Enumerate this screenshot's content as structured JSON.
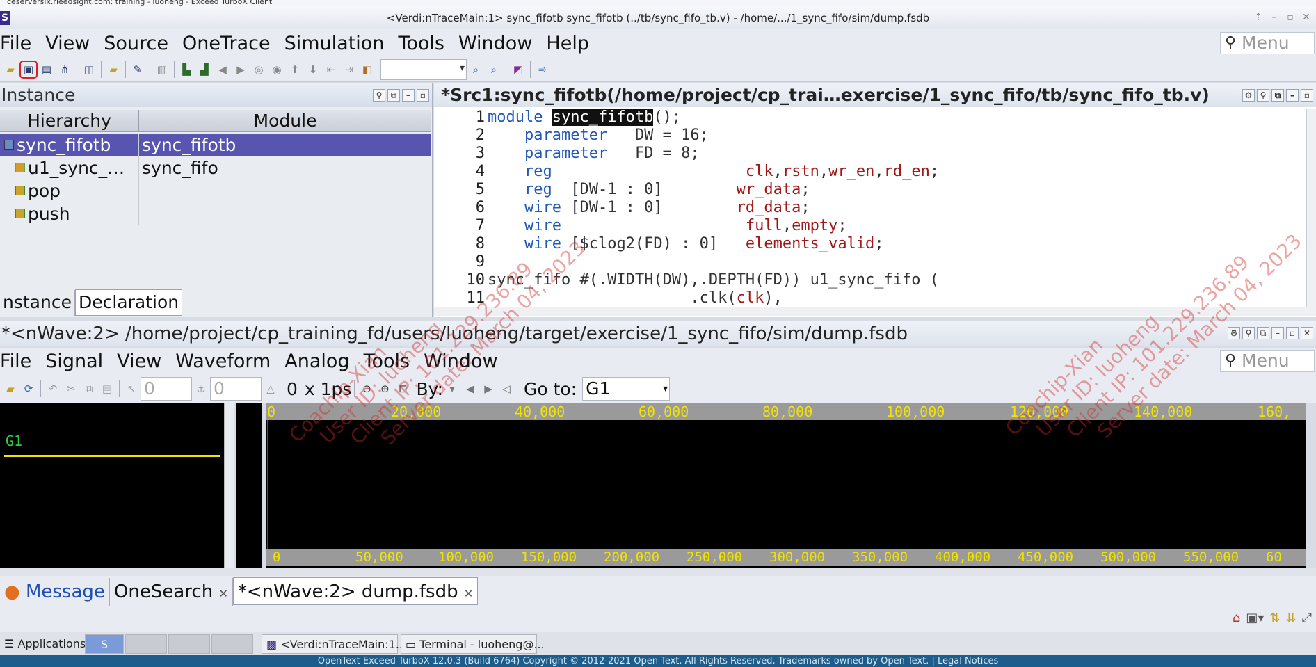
{
  "top_strip": {
    "text": "ceserversix.rieedsignt.com: training - luoheng - Exceed TurboX Client"
  },
  "title_bar": {
    "title": "<Verdi:nTraceMain:1> sync_fifotb sync_fifotb (../tb/sync_fifo_tb.v) - /home/.../1_sync_fifo/sim/dump.fsdb"
  },
  "main_menu": {
    "items": [
      "File",
      "View",
      "Source",
      "OneTrace",
      "Simulation",
      "Tools",
      "Window",
      "Help"
    ],
    "search_placeholder": "Menu"
  },
  "instance_panel": {
    "title": "Instance",
    "columns": [
      "Hierarchy",
      "Module"
    ],
    "rows": [
      {
        "name": "sync_fifotb",
        "module": "sync_fifotb",
        "selected": true
      },
      {
        "name": "u1_sync_…",
        "module": "sync_fifo",
        "selected": false
      },
      {
        "name": "pop",
        "module": "",
        "selected": false
      },
      {
        "name": "push",
        "module": "",
        "selected": false
      }
    ],
    "tabs": [
      "nstance",
      "Declaration"
    ]
  },
  "source_panel": {
    "title": "*Src1:sync_fifotb(/home/project/cp_trai…exercise/1_sync_fifo/tb/sync_fifo_tb.v)",
    "lines": [
      {
        "n": "1",
        "segs": [
          [
            "kw",
            "module "
          ],
          [
            "hl",
            "sync_fifotb"
          ],
          [
            "",
            "();"
          ]
        ]
      },
      {
        "n": "2",
        "segs": [
          [
            "",
            "    "
          ],
          [
            "kw",
            "parameter"
          ],
          [
            "",
            "   DW = 16;"
          ]
        ]
      },
      {
        "n": "3",
        "segs": [
          [
            "",
            "    "
          ],
          [
            "kw",
            "parameter"
          ],
          [
            "",
            "   FD = 8;"
          ]
        ]
      },
      {
        "n": "4",
        "segs": [
          [
            "",
            "    "
          ],
          [
            "kw",
            "reg"
          ],
          [
            "",
            "                     "
          ],
          [
            "sig",
            "clk"
          ],
          [
            "",
            ","
          ],
          [
            "sig",
            "rstn"
          ],
          [
            "",
            ","
          ],
          [
            "sig",
            "wr_en"
          ],
          [
            "",
            ","
          ],
          [
            "sig",
            "rd_en"
          ],
          [
            "",
            ";"
          ]
        ]
      },
      {
        "n": "5",
        "segs": [
          [
            "",
            "    "
          ],
          [
            "kw",
            "reg"
          ],
          [
            "",
            "  [DW-1 : 0]        "
          ],
          [
            "sig",
            "wr_data"
          ],
          [
            "",
            ";"
          ]
        ]
      },
      {
        "n": "6",
        "segs": [
          [
            "",
            "    "
          ],
          [
            "kw",
            "wire"
          ],
          [
            "",
            " [DW-1 : 0]        "
          ],
          [
            "sig",
            "rd_data"
          ],
          [
            "",
            ";"
          ]
        ]
      },
      {
        "n": "7",
        "segs": [
          [
            "",
            "    "
          ],
          [
            "kw",
            "wire"
          ],
          [
            "",
            "                    "
          ],
          [
            "sig",
            "full"
          ],
          [
            "",
            ","
          ],
          [
            "sig",
            "empty"
          ],
          [
            "",
            ";"
          ]
        ]
      },
      {
        "n": "8",
        "segs": [
          [
            "",
            "    "
          ],
          [
            "kw",
            "wire"
          ],
          [
            "",
            " [$clog2(FD) : 0]   "
          ],
          [
            "sig",
            "elements_valid"
          ],
          [
            "",
            ";"
          ]
        ]
      },
      {
        "n": "9",
        "segs": [
          [
            "",
            ""
          ]
        ]
      },
      {
        "n": "10",
        "segs": [
          [
            "",
            "sync_fifo #(.WIDTH(DW),.DEPTH(FD)) u1_sync_fifo ("
          ]
        ]
      },
      {
        "n": "11",
        "segs": [
          [
            "",
            "                      .clk("
          ],
          [
            "sig",
            "clk"
          ],
          [
            "",
            "),"
          ]
        ]
      }
    ]
  },
  "nwave": {
    "title": "*<nWave:2> /home/project/cp_training_fd/users/luoheng/target/exercise/1_sync_fifo/sim/dump.fsdb",
    "menu": [
      "File",
      "Signal",
      "View",
      "Waveform",
      "Analog",
      "Tools",
      "Window"
    ],
    "search_placeholder": "Menu",
    "cursor_field": "0",
    "marker_field": "0",
    "delta": "0",
    "unit": "x 1ps",
    "by_label": "By:",
    "goto_label": "Go to:",
    "goto_value": "G1",
    "signal_group": "G1",
    "ruler_top": [
      "0",
      "20,000",
      "40,000",
      "60,000",
      "80,000",
      "100,000",
      "120,000",
      "140,000",
      "160,"
    ],
    "ruler_bottom": [
      "0",
      "50,000",
      "100,000",
      "150,000",
      "200,000",
      "250,000",
      "300,000",
      "350,000",
      "400,000",
      "450,000",
      "500,000",
      "550,000",
      "60"
    ]
  },
  "bottom_tabs": [
    "Message",
    "OneSearch",
    "*<nWave:2> dump.fsdb"
  ],
  "taskbar": {
    "apps_label": "Applications",
    "tasks": [
      "<Verdi:nTraceMain:1...",
      "Terminal - luoheng@..."
    ]
  },
  "footer": {
    "text": "OpenText Exceed TurboX 12.0.3 (Build 6764) Copyright © 2012-2021 Open Text. All Rights Reserved. Trademarks owned by Open Text. | Legal Notices"
  },
  "watermark": {
    "left": [
      "Coachip-Xian",
      "User ID: luoheng",
      "Client IP: 101.229.236.89",
      "Server date: March 04, 2023"
    ],
    "right": [
      "Coachip-Xian",
      "User ID: luoheng",
      "Client IP: 101.229.236.89",
      "Server date: March 04, 2023"
    ]
  },
  "colors": {
    "selection": "#5855b0",
    "keyword": "#2258b8",
    "signal": "#a01818",
    "ruler_text": "#f2e400",
    "group_line": "#f2e400",
    "group_text": "#2ecc40"
  }
}
